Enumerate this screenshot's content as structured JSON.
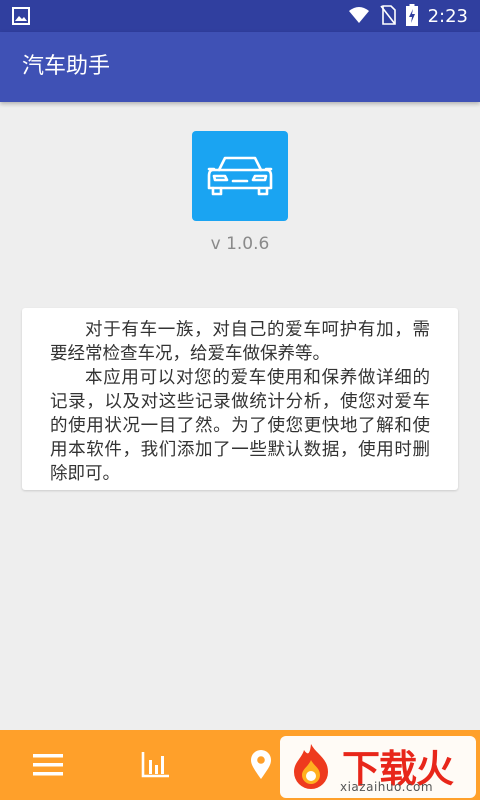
{
  "status_bar": {
    "time": "2:23",
    "icons": [
      "image-icon",
      "wifi-icon",
      "no-sim-icon",
      "battery-charging-icon"
    ]
  },
  "app_bar": {
    "title": "汽车助手"
  },
  "about": {
    "logo_icon": "car-icon",
    "version": "v 1.0.6",
    "description": "对于有车一族，对自己的爱车呵护有加，需要经常检查车况，给爱车做保养等。",
    "description2": "本应用可以对您的爱车使用和保养做详细的记录，以及对这些记录做统计分析，使您对爱车的使用状况一目了然。为了使您更快地了解和使用本软件，我们添加了一些默认数据，使用时删除即可。"
  },
  "bottom_nav": {
    "items": [
      "menu-icon",
      "chart-icon",
      "location-icon"
    ]
  },
  "watermark": {
    "title": "下载火",
    "url": "xiazaihuo.com"
  },
  "colors": {
    "status_bar": "#303f9f",
    "app_bar": "#3f51b5",
    "logo_bg": "#1aa4f2",
    "bottom_nav": "#ffa02a"
  }
}
